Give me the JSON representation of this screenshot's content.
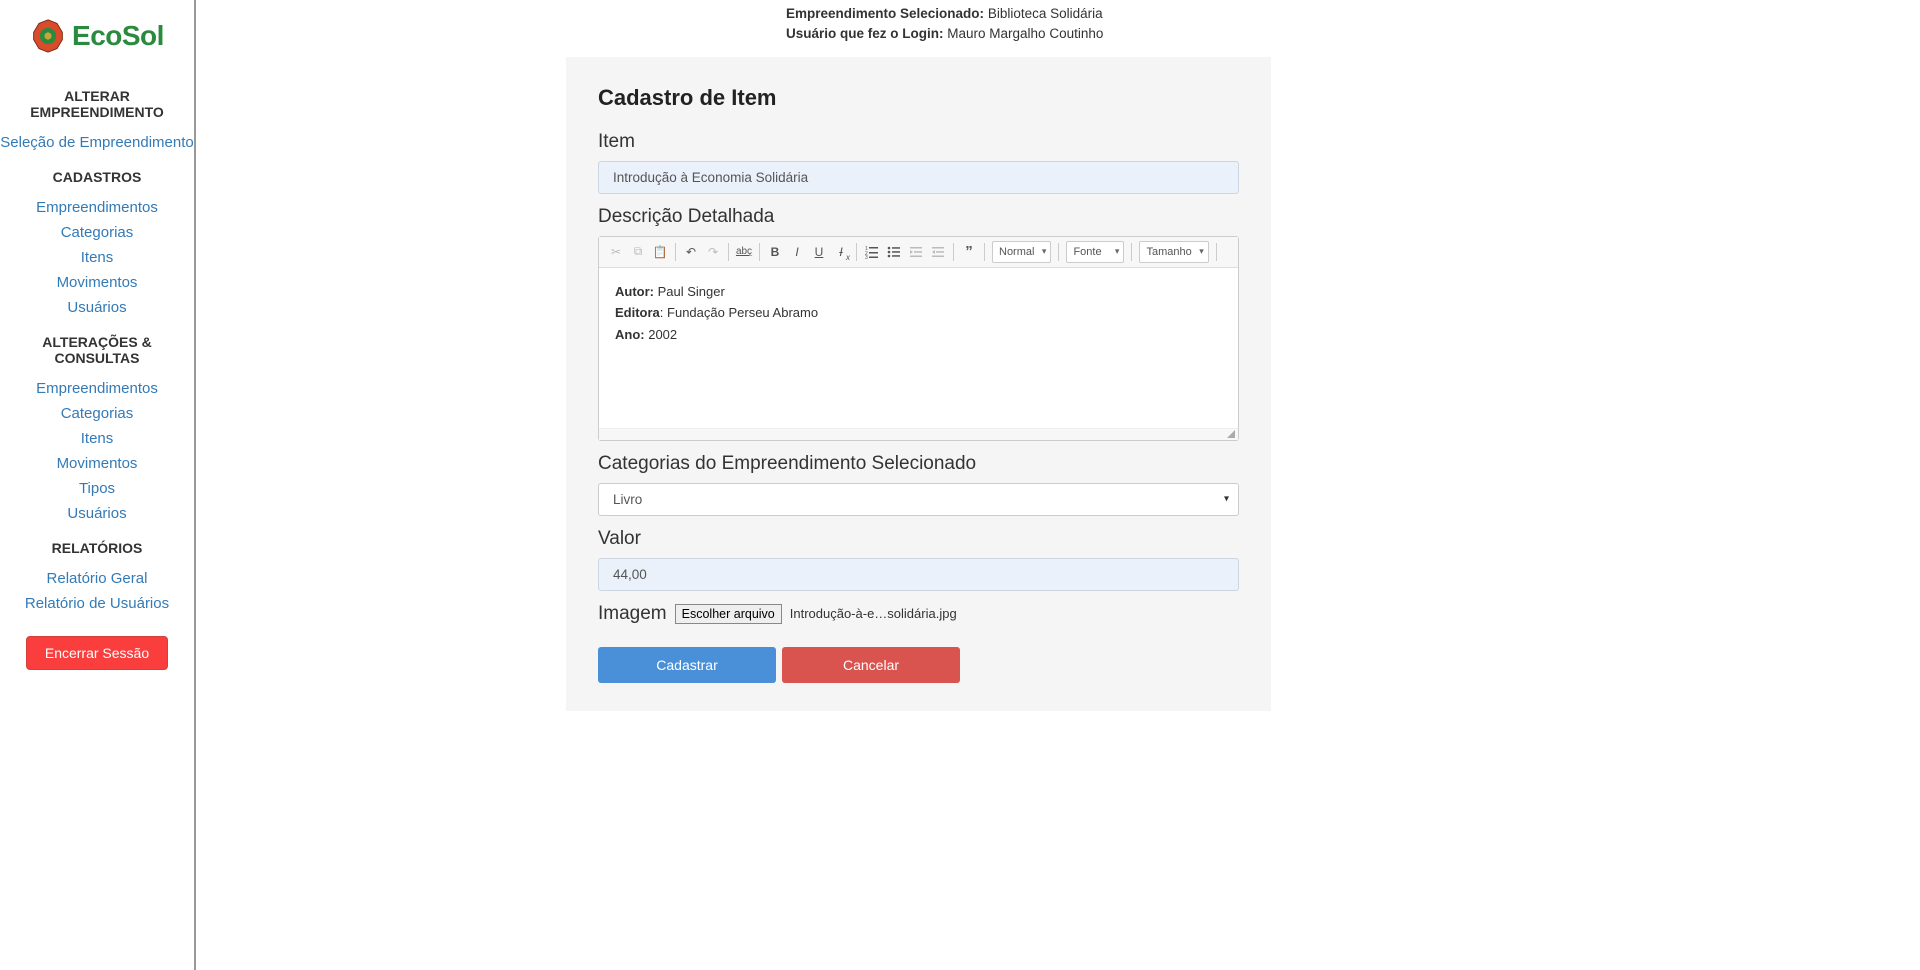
{
  "brand": {
    "name": "EcoSol"
  },
  "top": {
    "emp_label": "Empreendimento Selecionado:",
    "emp_value": "Biblioteca Solidária",
    "user_label": "Usuário que fez o Login:",
    "user_value": "Mauro Margalho Coutinho"
  },
  "sidebar": {
    "h1": "ALTERAR EMPREENDIMENTO",
    "sel_emp": "Seleção de Empreendimento",
    "h2": "CADASTROS",
    "cad": {
      "emp": "Empreendimentos",
      "cat": "Categorias",
      "itens": "Itens",
      "mov": "Movimentos",
      "usr": "Usuários"
    },
    "h3": "ALTERAÇÕES & CONSULTAS",
    "alt": {
      "emp": "Empreendimentos",
      "cat": "Categorias",
      "itens": "Itens",
      "mov": "Movimentos",
      "tipos": "Tipos",
      "usr": "Usuários"
    },
    "h4": "RELATÓRIOS",
    "rel": {
      "geral": "Relatório Geral",
      "usr": "Relatório de Usuários"
    },
    "logout": "Encerrar Sessão"
  },
  "form": {
    "title": "Cadastro de Item",
    "item_label": "Item",
    "item_value": "Introdução à Economia Solidária",
    "desc_label": "Descrição Detalhada",
    "desc": {
      "autor_k": "Autor:",
      "autor_v": " Paul Singer",
      "editora_k": "Editora",
      "editora_sep": ": ",
      "editora_v": "Fundação Perseu Abramo",
      "ano_k": "Ano:",
      "ano_v": " 2002"
    },
    "cat_label": "Categorias do Empreendimento Selecionado",
    "cat_value": "Livro",
    "valor_label": "Valor",
    "valor_value": "44,00",
    "img_label": "Imagem",
    "file_btn": "Escolher arquivo",
    "file_name": "Introdução-à-e…solidária.jpg",
    "submit": "Cadastrar",
    "cancel": "Cancelar"
  },
  "toolbar": {
    "format_normal": "Normal",
    "font": "Fonte",
    "size": "Tamanho"
  }
}
